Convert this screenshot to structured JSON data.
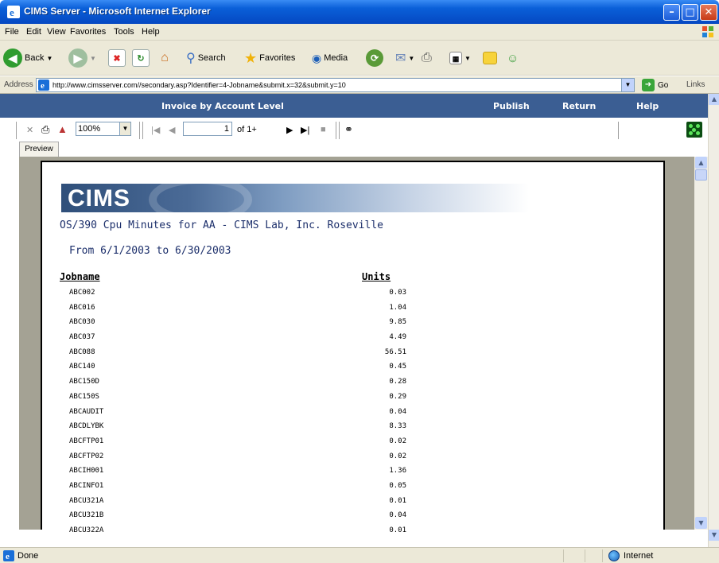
{
  "window": {
    "title": "CIMS Server - Microsoft Internet Explorer",
    "minimize": "–",
    "maximize": "□",
    "close": "✕"
  },
  "menu": [
    "File",
    "Edit",
    "View",
    "Favorites",
    "Tools",
    "Help"
  ],
  "toolbar": {
    "back": "Back",
    "search": "Search",
    "favorites": "Favorites",
    "media": "Media"
  },
  "address": {
    "label": "Address",
    "url": "http://www.cimsserver.com//secondary.asp?Identifier=4-Jobname&submit.x=32&submit.y=10",
    "go": "Go",
    "links": "Links"
  },
  "app_bar": {
    "title": "Invoice by Account Level",
    "publish": "Publish",
    "return": "Return",
    "help": "Help"
  },
  "viewer": {
    "zoom": "100%",
    "page": "1",
    "page_of": "of 1+",
    "tab": "Preview"
  },
  "report": {
    "logo": "CIMS",
    "title": "OS/390 Cpu Minutes for  AA - CIMS Lab, Inc. Roseville",
    "range": "From 6/1/2003 to 6/30/2003",
    "col_jobname": "Jobname",
    "col_units": "Units",
    "rows": [
      {
        "job": "ABC002",
        "units": "0.03"
      },
      {
        "job": "ABC016",
        "units": "1.04"
      },
      {
        "job": "ABC030",
        "units": "9.85"
      },
      {
        "job": "ABC037",
        "units": "4.49"
      },
      {
        "job": "ABC088",
        "units": "56.51"
      },
      {
        "job": "ABC140",
        "units": "0.45"
      },
      {
        "job": "ABC150D",
        "units": "0.28"
      },
      {
        "job": "ABC150S",
        "units": "0.29"
      },
      {
        "job": "ABCAUDIT",
        "units": "0.04"
      },
      {
        "job": "ABCDLYBK",
        "units": "8.33"
      },
      {
        "job": "ABCFTP01",
        "units": "0.02"
      },
      {
        "job": "ABCFTP02",
        "units": "0.02"
      },
      {
        "job": "ABCIH001",
        "units": "1.36"
      },
      {
        "job": "ABCINFO1",
        "units": "0.05"
      },
      {
        "job": "ABCU321A",
        "units": "0.01"
      },
      {
        "job": "ABCU321B",
        "units": "0.04"
      },
      {
        "job": "ABCU322A",
        "units": "0.01"
      }
    ]
  },
  "status": {
    "text": "Done",
    "zone": "Internet"
  },
  "colors": {
    "titlebar": "#0a5fd8",
    "app_bar": "#3b5e93",
    "report_text": "#1c2f6b"
  }
}
